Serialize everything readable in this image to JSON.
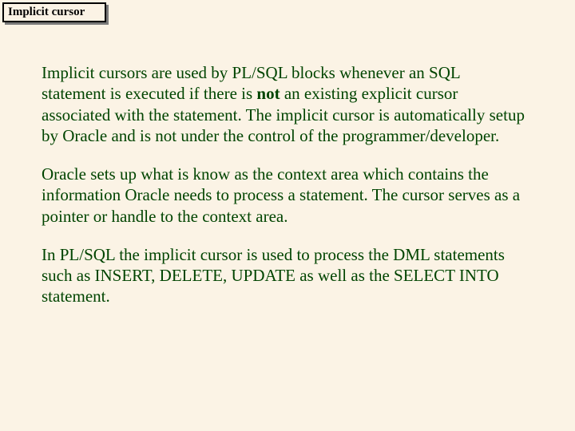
{
  "title": "Implicit cursor",
  "p1a": "Implicit cursors are used by PL/SQL blocks whenever an SQL statement is executed if there is ",
  "p1b": "not",
  "p1c": " an existing explicit cursor associated with the statement. The implicit cursor is automatically setup by Oracle and is not under the control of the programmer/developer.",
  "p2": "Oracle sets up what is know as the context area which contains the information Oracle needs to process a statement.  The cursor serves as a pointer or handle to the context area.",
  "p3": "In PL/SQL the implicit cursor is used to process the DML statements such as INSERT, DELETE, UPDATE as well as the SELECT INTO statement."
}
